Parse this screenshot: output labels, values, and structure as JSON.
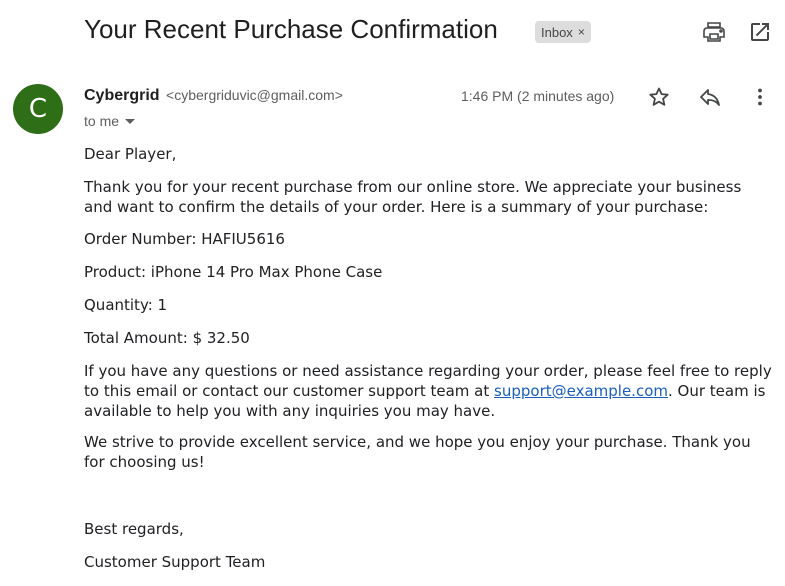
{
  "email": {
    "subject": "Your Recent Purchase Confirmation",
    "label": "Inbox",
    "label_remove": "×",
    "sender_name": "Cybergrid",
    "sender_email": "<cybergriduvic@gmail.com>",
    "avatar_letter": "C",
    "timestamp": "1:46 PM (2 minutes ago)",
    "recipient": "to me",
    "greeting": "Dear Player,",
    "intro": "Thank you for your recent purchase from our online store. We appreciate your business and want to confirm the details of your order. Here is a summary of your purchase:",
    "order_number": "Order Number: HAFIU5616",
    "product": "Product: iPhone 14 Pro Max Phone Case",
    "quantity": "Quantity: 1",
    "total": "Total Amount: $ 32.50",
    "support_pre": "If you have any questions or need assistance regarding your order, please feel free to reply to this email or contact our customer support team at ",
    "support_link": "support@example.com",
    "support_post": ". Our team is available to help you with any inquiries you may have.",
    "closing_para": "We strive to provide excellent service, and we hope you enjoy your purchase. Thank you for choosing us!",
    "sign_off": "Best regards,",
    "signature": "Customer Support Team"
  },
  "icons": {
    "print": "print-icon",
    "popout": "open-in-new-window-icon",
    "star": "star-icon",
    "reply": "reply-icon",
    "more": "more-vert-icon",
    "recipient_caret": "chevron-down-icon"
  },
  "colors": {
    "avatar_bg": "#2e6e17",
    "link": "#1a5fbf",
    "label_chip_bg": "#dddddd"
  }
}
